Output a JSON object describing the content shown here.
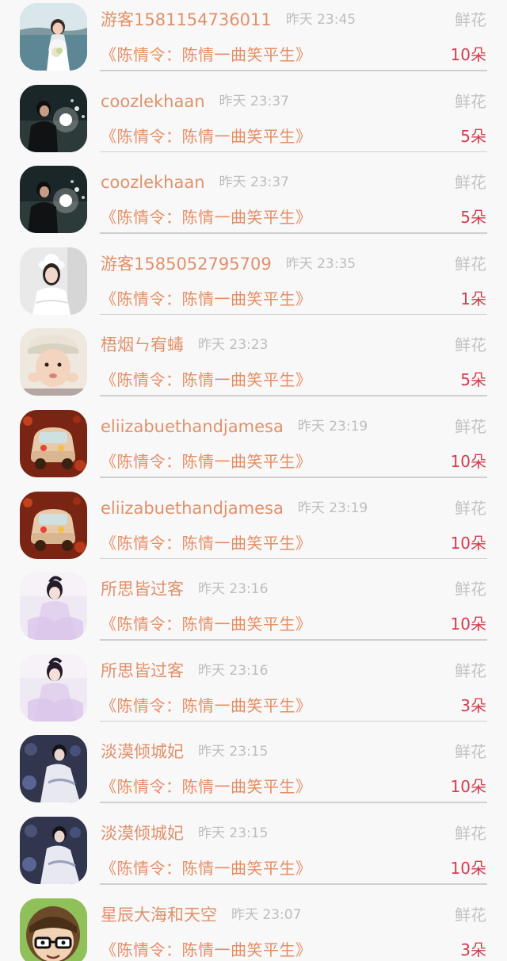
{
  "records": [
    {
      "user": "游客1581154736011",
      "time": "昨天 23:45",
      "gift": "鲜花",
      "song": "《陈情令：陈情一曲笑平生》",
      "count": "10朵",
      "avatar": "bride-lake-avatar"
    },
    {
      "user": "coozlekhaan",
      "time": "昨天 23:37",
      "gift": "鲜花",
      "song": "《陈情令：陈情一曲笑平生》",
      "count": "5朵",
      "avatar": "night-street-avatar"
    },
    {
      "user": "coozlekhaan",
      "time": "昨天 23:37",
      "gift": "鲜花",
      "song": "《陈情令：陈情一曲笑平生》",
      "count": "5朵",
      "avatar": "night-street-avatar"
    },
    {
      "user": "游客1585052795709",
      "time": "昨天 23:35",
      "gift": "鲜花",
      "song": "《陈情令：陈情一曲笑平生》",
      "count": "1朵",
      "avatar": "girl-white-hat-avatar"
    },
    {
      "user": "梧烟ㄣ宥蝳",
      "time": "昨天 23:23",
      "gift": "鲜花",
      "song": "《陈情令：陈情一曲笑平生》",
      "count": "5朵",
      "avatar": "child-cap-avatar"
    },
    {
      "user": "eliizabuethandjamesa",
      "time": "昨天 23:19",
      "gift": "鲜花",
      "song": "《陈情令：陈情一曲笑平生》",
      "count": "10朵",
      "avatar": "toy-car-avatar"
    },
    {
      "user": "eliizabuethandjamesa",
      "time": "昨天 23:19",
      "gift": "鲜花",
      "song": "《陈情令：陈情一曲笑平生》",
      "count": "10朵",
      "avatar": "toy-car-avatar"
    },
    {
      "user": "所思皆过客",
      "time": "昨天 23:16",
      "gift": "鲜花",
      "song": "《陈情令：陈情一曲笑平生》",
      "count": "10朵",
      "avatar": "costume-girl-avatar"
    },
    {
      "user": "所思皆过客",
      "time": "昨天 23:16",
      "gift": "鲜花",
      "song": "《陈情令：陈情一曲笑平生》",
      "count": "3朵",
      "avatar": "costume-girl-avatar"
    },
    {
      "user": "淡漠倾城妃",
      "time": "昨天 23:15",
      "gift": "鲜花",
      "song": "《陈情令：陈情一曲笑平生》",
      "count": "10朵",
      "avatar": "costume-man-avatar"
    },
    {
      "user": "淡漠倾城妃",
      "time": "昨天 23:15",
      "gift": "鲜花",
      "song": "《陈情令：陈情一曲笑平生》",
      "count": "10朵",
      "avatar": "costume-man-avatar"
    },
    {
      "user": "星辰大海和天空",
      "time": "昨天 23:07",
      "gift": "鲜花",
      "song": "《陈情令：陈情一曲笑平生》",
      "count": "3朵",
      "avatar": "cartoon-glasses-avatar"
    }
  ],
  "colors": {
    "username": "#e0916a",
    "song": "#e58e63",
    "count": "#d23d4e",
    "meta": "#bdbdbd",
    "background": "#f9f8f9"
  }
}
